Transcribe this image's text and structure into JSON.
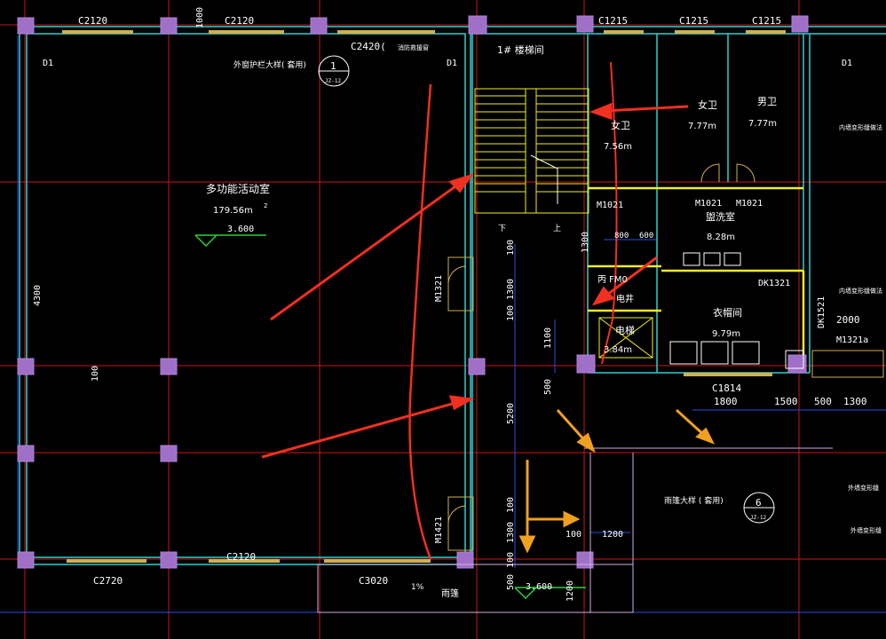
{
  "colors": {
    "background": "#000000",
    "wall": "#2fd0d0",
    "axis": "#d01818",
    "column": "#a070c8",
    "window": "#d0b050",
    "dimension": "#2850e0",
    "text": "#ffffff",
    "partition": "#f0f020",
    "annotation_red": "#f03020",
    "annotation_orange": "#f0a020"
  },
  "window_tags": {
    "top_left_1": "C2120",
    "top_left_2": "C2120",
    "top_stair": "C2420(",
    "top_stair_note": "消防救援窗",
    "top_right_1": "C1215",
    "top_right_2": "C1215",
    "top_right_3": "C1215",
    "bottom_mid": "C2120",
    "bottom_left": "C2720",
    "bottom_right": "C3020",
    "bottom_right_room": "C1814"
  },
  "doors": {
    "d1_left": "D1",
    "d1_mid": "D1",
    "d1_right": "D1",
    "m1321": "M1321",
    "m1421": "M1421",
    "m1021_a": "M1021",
    "m1021_b": "M1021",
    "m1021_c": "M1021",
    "fm": "丙 FM0",
    "dk1321": "DK1321",
    "dk1521": "DK1521",
    "m1321a": "M1321a"
  },
  "rooms": {
    "activity_name": "多功能活动室",
    "activity_area": "179.56m",
    "activity_level": "3.600",
    "stair_name": "1# 楼梯间",
    "stair_down": "下",
    "stair_up": "上",
    "female_wc_a": "女卫",
    "female_wc_a_area": "7.77m",
    "male_wc": "男卫",
    "male_wc_area": "7.77m",
    "female_wc_b": "女卫",
    "female_wc_b_area": "7.56m",
    "washroom": "盥洗室",
    "washroom_area": "8.28m",
    "cloakroom": "衣帽间",
    "cloakroom_area": "9.79m",
    "elevator": "电梯",
    "elevator_area": "3.84m",
    "shaft": "电井",
    "sq": "2",
    "floor_level_bottom": "3.600",
    "canopy": "雨篷",
    "canopy_slope": "1%",
    "right_note_1": "内墙变形缝做法",
    "right_note_2": "内墙变形缝做法",
    "right_note_3": "外墙变形缝",
    "right_note_4": "外墙变形缝"
  },
  "notes": {
    "railing_detail": "外窗护栏大样( 套用)",
    "canopy_detail": "雨篷大样 ( 套用)"
  },
  "detail_marks": {
    "mark1_num": "1",
    "mark1_ref": "JZ-12",
    "mark6_num": "6",
    "mark6_ref": "JZ-12"
  },
  "dimensions": {
    "left_vert": "4300",
    "left_vert_2": "100",
    "corr_100_a": "100",
    "corr_1300_a": "1300",
    "corr_100_b": "100",
    "corr_1100": "1100",
    "corr_500": "500",
    "corr_5200": "5200",
    "corr_100_c": "100",
    "corr_1300_b": "1300",
    "corr_100_d": "100",
    "corr_500_b": "500",
    "top_1000": "1000",
    "wash_800": "800",
    "wash_600": "600",
    "wash_1300": "1300",
    "d_1800": "1800",
    "d_1500": "1500",
    "d_500": "500",
    "d_1300": "1300",
    "d_2000": "2000",
    "canopy_1200": "1200",
    "canopy_1200_v": "1200",
    "canopy_100": "100"
  }
}
